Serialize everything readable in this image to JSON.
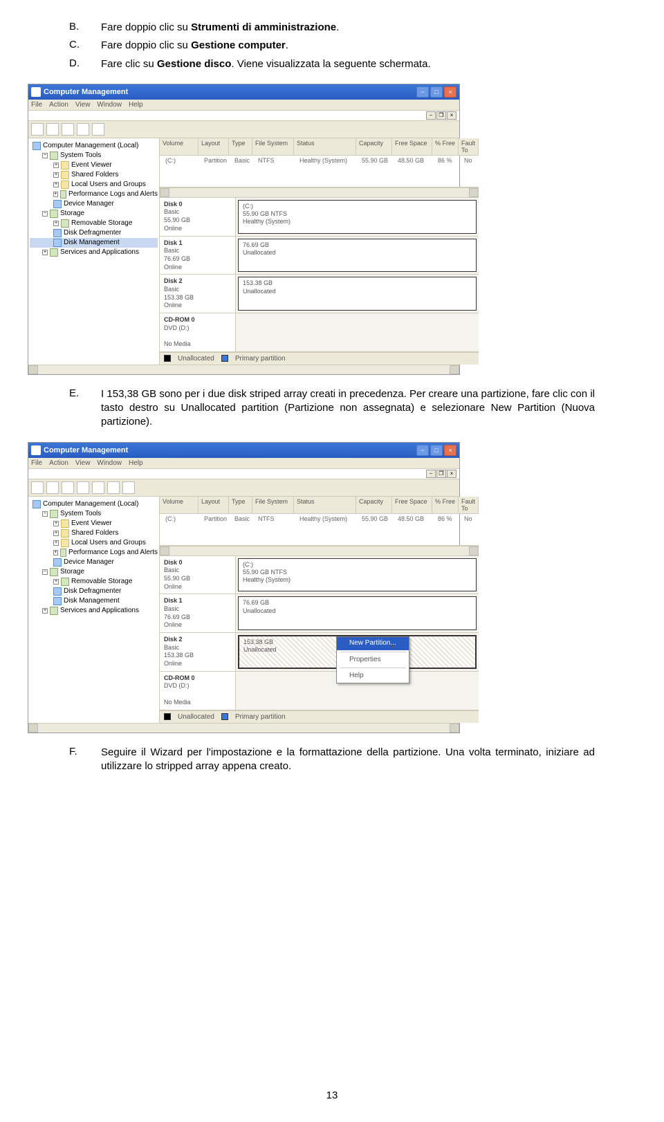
{
  "bullets": {
    "B": {
      "marker": "B.",
      "pre": "Fare doppio clic su ",
      "bold": "Strumenti di amministrazione",
      "post": "."
    },
    "C": {
      "marker": "C.",
      "pre": "Fare doppio clic su ",
      "bold": "Gestione computer",
      "post": "."
    },
    "D": {
      "marker": "D.",
      "pre": "Fare clic su ",
      "bold": "Gestione disco",
      "post": ". Viene visualizzata la seguente schermata."
    },
    "E": {
      "marker": "E.",
      "text": "I 153,38 GB sono per i due disk striped array creati in precedenza. Per creare una partizione, fare clic con il tasto destro su Unallocated partition (Partizione non assegnata) e selezionare New Partition (Nuova partizione)."
    },
    "F": {
      "marker": "F.",
      "text": "Seguire il Wizard per l'impostazione e la formattazione della partizione. Una volta terminato, iniziare ad utilizzare lo stripped array appena creato."
    }
  },
  "cm": {
    "title": "Computer Management",
    "menus": [
      "File",
      "Action",
      "View",
      "Window",
      "Help"
    ],
    "tree": {
      "root": "Computer Management (Local)",
      "systools": "System Tools",
      "eventviewer": "Event Viewer",
      "shared": "Shared Folders",
      "localusers": "Local Users and Groups",
      "perf": "Performance Logs and Alerts",
      "devmgr": "Device Manager",
      "storage": "Storage",
      "removable": "Removable Storage",
      "defrag": "Disk Defragmenter",
      "diskmgmt": "Disk Management",
      "services": "Services and Applications"
    },
    "vol_headers": [
      "Volume",
      "Layout",
      "Type",
      "File System",
      "Status",
      "Capacity",
      "Free Space",
      "% Free",
      "Fault To"
    ],
    "vol_row": [
      "(C:)",
      "Partition",
      "Basic",
      "NTFS",
      "Healthy (System)",
      "55.90 GB",
      "48.50 GB",
      "86 %",
      "No"
    ],
    "disks": {
      "d0": {
        "title": "Disk 0",
        "sub": "Basic\n55.90 GB\nOnline",
        "part": "(C:)\n55.90 GB NTFS\nHealthy (System)"
      },
      "d1": {
        "title": "Disk 1",
        "sub": "Basic\n76.69 GB\nOnline",
        "part": "76.69 GB\nUnallocated"
      },
      "d2": {
        "title": "Disk 2",
        "sub": "Basic\n153.38 GB\nOnline",
        "part": "153.38 GB\nUnallocated"
      },
      "cd": {
        "title": "CD-ROM 0",
        "sub": "DVD (D:)\n\nNo Media",
        "part": ""
      }
    },
    "legend": {
      "a": "Unallocated",
      "b": "Primary partition"
    },
    "context": {
      "newpart": "New Partition...",
      "props": "Properties",
      "help": "Help"
    }
  },
  "page_num": "13"
}
